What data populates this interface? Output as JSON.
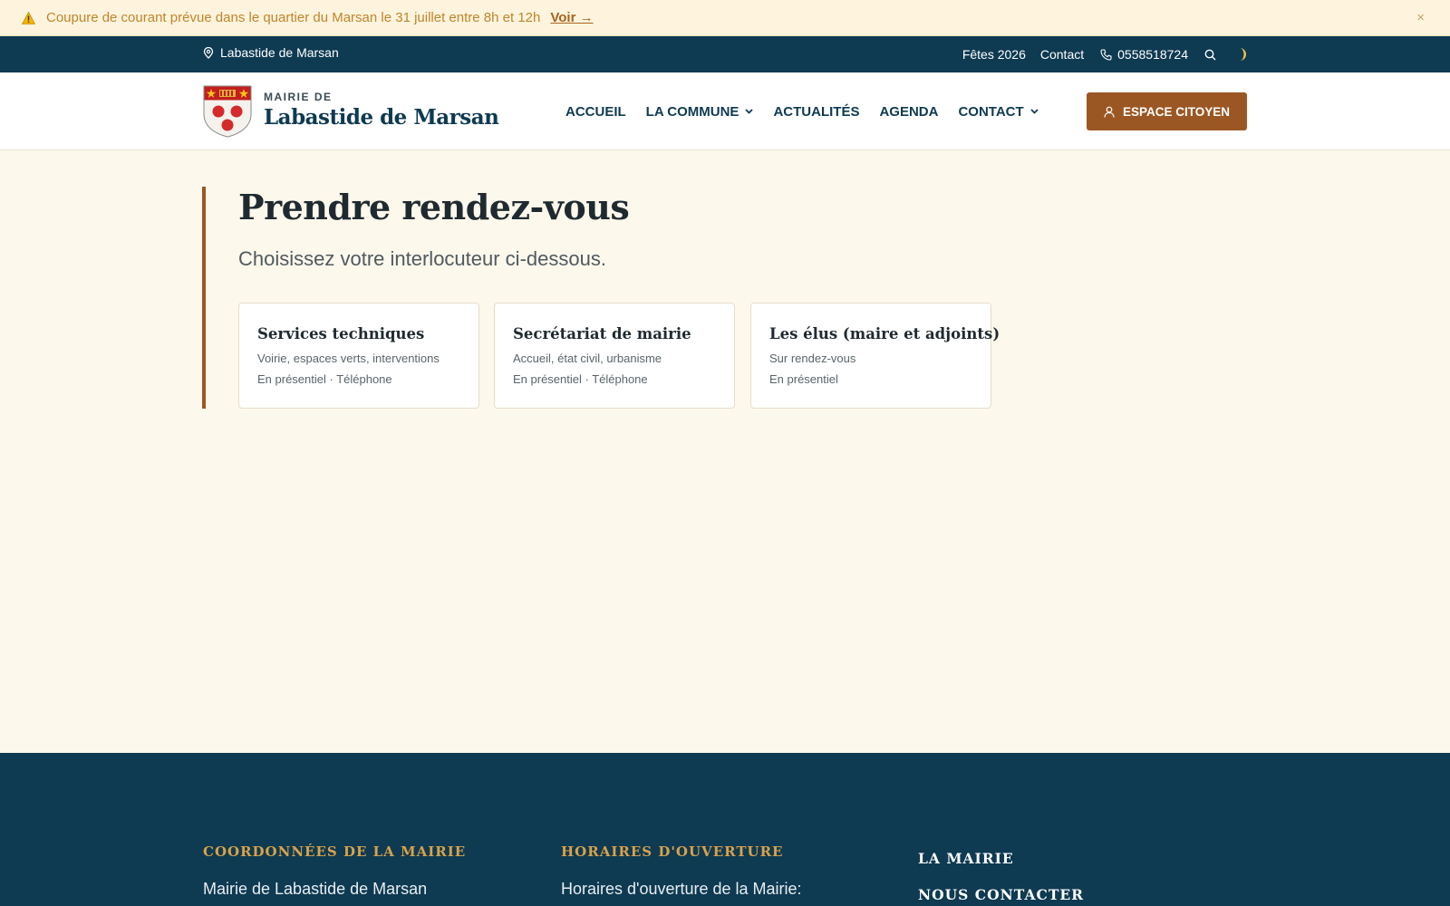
{
  "alert": {
    "text": "Coupure de courant prévue dans le quartier du Marsan le 31 juillet entre 8h et 12h",
    "link": "Voir →",
    "close": "×"
  },
  "topbar": {
    "location": "Labastide de Marsan",
    "links": [
      "Fêtes 2026",
      "Contact"
    ],
    "phone": "0558518724"
  },
  "header": {
    "brand_small": "MAIRIE DE",
    "brand_big": "Labastide de Marsan",
    "nav": [
      {
        "label": "ACCUEIL",
        "dropdown": false
      },
      {
        "label": "LA COMMUNE",
        "dropdown": true
      },
      {
        "label": "ACTUALITÉS",
        "dropdown": false
      },
      {
        "label": "AGENDA",
        "dropdown": false
      },
      {
        "label": "CONTACT",
        "dropdown": true
      }
    ],
    "cta": "ESPACE CITOYEN"
  },
  "main": {
    "title": "Prendre rendez-vous",
    "subtitle": "Choisissez votre interlocuteur ci-dessous.",
    "cards": [
      {
        "title": "Services techniques",
        "desc": "Voirie, espaces verts, interventions",
        "mode": "En présentiel · Téléphone"
      },
      {
        "title": "Secrétariat de mairie",
        "desc": "Accueil, état civil, urbanisme",
        "mode": "En présentiel · Téléphone"
      },
      {
        "title": "Les élus (maire et adjoints)",
        "desc": "Sur rendez-vous",
        "mode": "En présentiel"
      }
    ]
  },
  "footer": {
    "col1_title": "COORDONNÉES DE LA MAIRIE",
    "col1_text": "Mairie de Labastide de Marsan",
    "col2_title": "HORAIRES D'OUVERTURE",
    "col2_text": "Horaires d'ouverture de la Mairie:",
    "links": [
      "LA MAIRIE",
      "NOUS CONTACTER"
    ]
  },
  "colors": {
    "primary": "#0e3a52",
    "accent": "#9b5723",
    "gold": "#d9a24a",
    "alert_bg": "#fef4dd",
    "background": "#fdf8ec"
  }
}
